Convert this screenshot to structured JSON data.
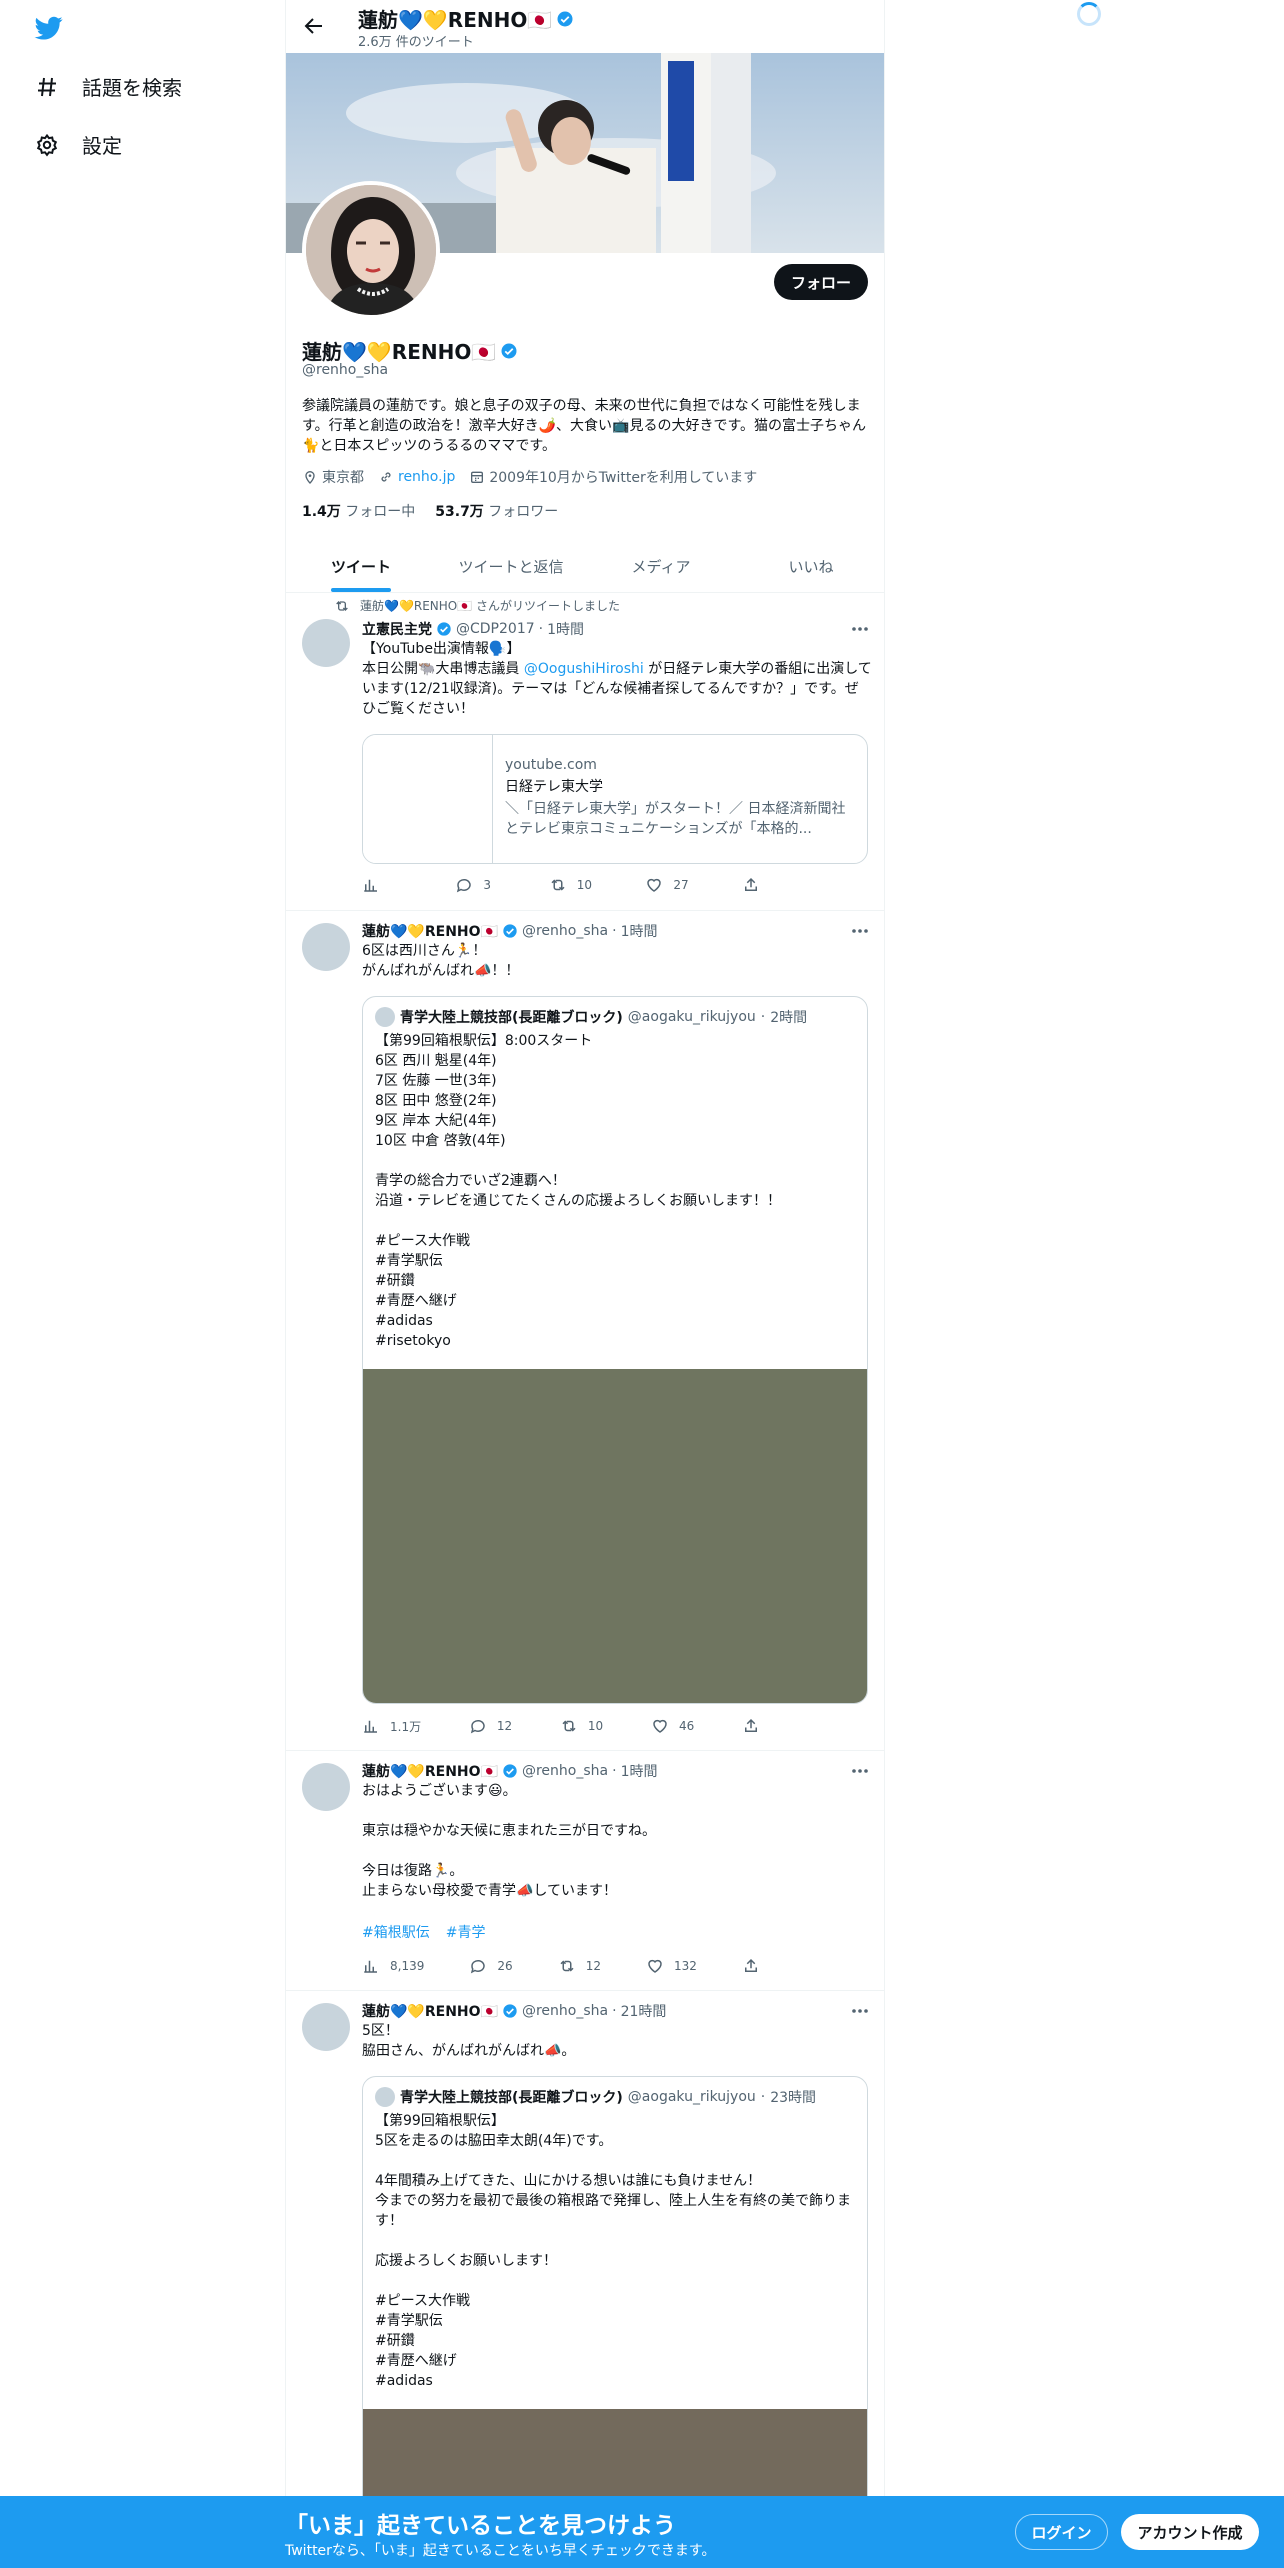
{
  "nav": {
    "explore_label": "話題を検索",
    "settings_label": "設定"
  },
  "topbar": {
    "name": "蓮舫💙💛RENHO🇯🇵",
    "tweet_count": "2.6万 件のツイート"
  },
  "profile": {
    "follow_label": "フォロー",
    "name": "蓮舫💙💛RENHO🇯🇵",
    "handle": "@renho_sha",
    "bio": "参議院議員の蓮舫です。娘と息子の双子の母、未来の世代に負担ではなく可能性を残します。行革と創造の政治を！激辛大好き🌶️、大食い📺見るの大好きです。猫の富士子ちゃん🐈と日本スピッツのうるるのママです。",
    "location": "東京都",
    "website": "renho.jp",
    "joined": "2009年10月からTwitterを利用しています",
    "following_count": "1.4万",
    "following_label": "フォロー中",
    "followers_count": "53.7万",
    "followers_label": "フォロワー"
  },
  "tabs": [
    "ツイート",
    "ツイートと返信",
    "メディア",
    "いいね"
  ],
  "tweets": [
    {
      "retweet_note": "蓮舫💙💛RENHO🇯🇵 さんがリツイートしました",
      "name": "立憲民主党",
      "handle": "@CDP2017",
      "time": "1時間",
      "text_a": "【YouTube出演情報🗣️】\n本日公開🐃大串博志議員 ",
      "mention": "@OogushiHiroshi",
      "text_b": " が日経テレ東大学の番組に出演しています(12/21収録済)。テーマは「どんな候補者探してるんですか？」です。ぜひご覧ください！",
      "card": {
        "domain": "youtube.com",
        "title": "日経テレ東大学",
        "desc": "＼「日経テレ東大学」がスタート！／ 日本経済新聞社とテレビ東京コミュニケーションズが「本格的..."
      },
      "stats": {
        "views": "",
        "replies": "3",
        "retweets": "10",
        "likes": "27"
      }
    },
    {
      "name": "蓮舫💙💛RENHO🇯🇵",
      "handle": "@renho_sha",
      "time": "1時間",
      "text": "6区は西川さん🏃！\nがんばれがんばれ📣！！",
      "quote": {
        "name": "青学大陸上競技部(長距離ブロック)",
        "handle": "@aogaku_rikujyou",
        "time": "2時間",
        "text": "【第99回箱根駅伝】8:00スタート\n6区 西川 魁星(4年)\n7区 佐藤 一世(3年)\n8区 田中 悠登(2年)\n9区 岸本 大紀(4年)\n10区 中倉 啓敦(4年)\n\n青学の総合力でいざ2連覇へ！\n沿道・テレビを通じてたくさんの応援よろしくお願いします！！\n\n#ピース大作戦\n#青学駅伝\n#研鑽\n#青歴へ継げ\n#adidas\n#risetokyo",
        "media_color": "#6f7560"
      },
      "stats": {
        "views": "1.1万",
        "replies": "12",
        "retweets": "10",
        "likes": "46"
      }
    },
    {
      "name": "蓮舫💙💛RENHO🇯🇵",
      "handle": "@renho_sha",
      "time": "1時間",
      "text": "おはようございます😃。\n\n東京は穏やかな天候に恵まれた三が日ですね。\n\n今日は復路🏃。\n止まらない母校愛で青学📣しています！",
      "hashtags": [
        "#箱根駅伝",
        "#青学"
      ],
      "stats": {
        "views": "8,139",
        "replies": "26",
        "retweets": "12",
        "likes": "132"
      }
    },
    {
      "name": "蓮舫💙💛RENHO🇯🇵",
      "handle": "@renho_sha",
      "time": "21時間",
      "text": "5区！\n脇田さん、がんばれがんばれ📣。",
      "quote": {
        "name": "青学大陸上競技部(長距離ブロック)",
        "handle": "@aogaku_rikujyou",
        "time": "23時間",
        "text": "【第99回箱根駅伝】\n5区を走るのは脇田幸太朗(4年)です。\n\n4年間積み上げてきた、山にかける想いは誰にも負けません！\n今までの努力を最初で最後の箱根路で発揮し、陸上人生を有終の美で飾ります！\n\n応援よろしくお願いします！\n\n#ピース大作戦\n#青学駅伝\n#研鑽\n#青歴へ継げ\n#adidas",
        "media_color": "#736a5c"
      }
    }
  ],
  "bottom": {
    "title": "「いま」起きていることを見つけよう",
    "subtitle": "Twitterなら、「いま」起きていることをいち早くチェックできます。",
    "login_label": "ログイン",
    "signup_label": "アカウント作成"
  },
  "colors": {
    "accent": "#1d9bf0",
    "text": "#0f1419",
    "muted": "#536471"
  }
}
